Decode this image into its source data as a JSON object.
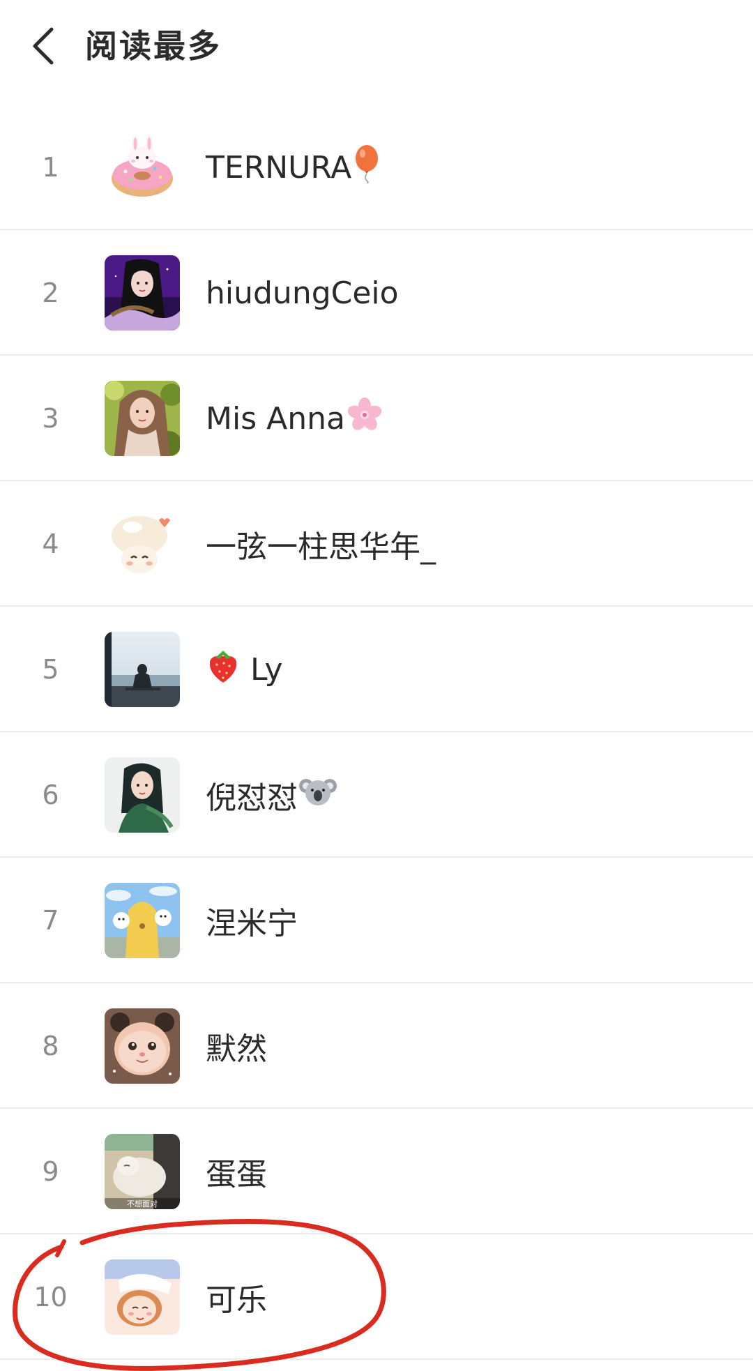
{
  "header": {
    "title": "阅读最多"
  },
  "list": [
    {
      "rank": "1",
      "name": "TERNURA"
    },
    {
      "rank": "2",
      "name": "hiudungCeio"
    },
    {
      "rank": "3",
      "name": "Mis Anna"
    },
    {
      "rank": "4",
      "name": "一弦一柱思华年_"
    },
    {
      "rank": "5",
      "name": "Ly"
    },
    {
      "rank": "6",
      "name": "倪怼怼"
    },
    {
      "rank": "7",
      "name": "涅米宁"
    },
    {
      "rank": "8",
      "name": "默然"
    },
    {
      "rank": "9",
      "name": "蛋蛋"
    },
    {
      "rank": "10",
      "name": "可乐"
    }
  ],
  "avatar_watermark": "不想面对",
  "colors": {
    "annotation_circle": "#d92b1f",
    "divider": "#ececec",
    "rank_text": "#8a8a8a"
  },
  "icons": {
    "back": "chevron-left-icon",
    "balloon": "balloon-emoji-icon",
    "blossom": "cherry-blossom-emoji-icon",
    "strawberry": "strawberry-emoji-icon",
    "koala": "koala-emoji-icon"
  }
}
